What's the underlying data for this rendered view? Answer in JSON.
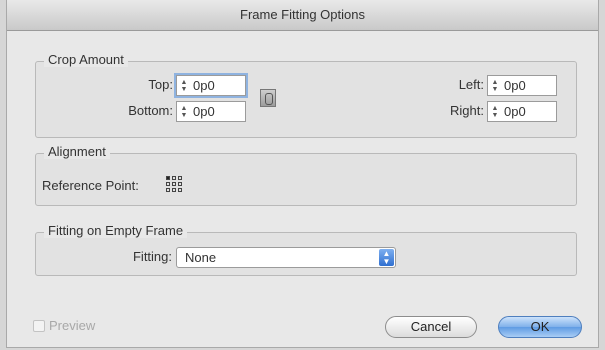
{
  "dialog": {
    "title": "Frame Fitting Options"
  },
  "crop_amount": {
    "title": "Crop Amount",
    "top": {
      "label": "Top:",
      "value": "0p0"
    },
    "bottom": {
      "label": "Bottom:",
      "value": "0p0"
    },
    "left": {
      "label": "Left:",
      "value": "0p0"
    },
    "right": {
      "label": "Right:",
      "value": "0p0"
    }
  },
  "alignment": {
    "title": "Alignment",
    "reference_point_label": "Reference Point:"
  },
  "fitting_empty": {
    "title": "Fitting on Empty Frame",
    "fitting_label": "Fitting:",
    "fitting_value": "None"
  },
  "footer": {
    "preview_label": "Preview",
    "preview_checked": false,
    "cancel_label": "Cancel",
    "ok_label": "OK"
  },
  "icons": {
    "chain": "chain-link-icon",
    "reference_point": "reference-point-icon",
    "stepper": "stepper-arrows-icon"
  }
}
